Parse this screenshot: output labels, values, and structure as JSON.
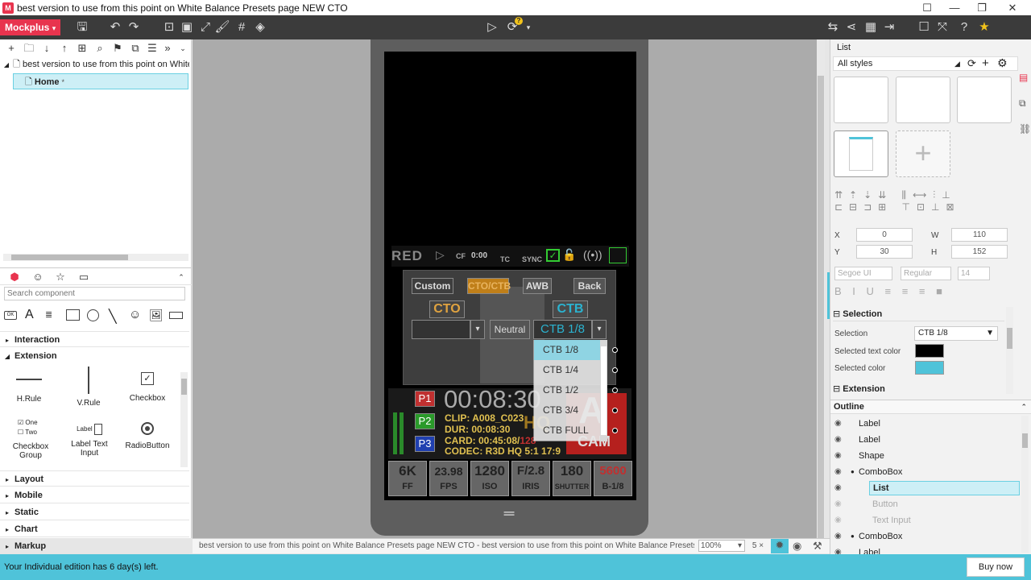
{
  "window": {
    "title": "best version to use from this point on White Balance Presets page NEW CTO",
    "app_badge": "M"
  },
  "toolbar": {
    "brand": "Mockplus",
    "brand_arrow": "▾",
    "update_badge": "?"
  },
  "pages": {
    "project_name": "best version to use from this point on White B",
    "home": "Home",
    "home_marker": "*"
  },
  "components": {
    "search_placeholder": "Search component",
    "sections": {
      "interaction": "Interaction",
      "extension": "Extension",
      "layout": "Layout",
      "mobile": "Mobile",
      "static": "Static",
      "chart": "Chart",
      "markup": "Markup"
    },
    "items": {
      "hrule": "H.Rule",
      "vrule": "V.Rule",
      "checkbox": "Checkbox",
      "checkbox_group": "Checkbox Group",
      "cbg_one": "One",
      "cbg_two": "Two",
      "label_text_input": "Label Text Input",
      "ltl": "Label",
      "radio_button": "RadioButton"
    },
    "icons": {
      "button": "OK",
      "text": "A"
    }
  },
  "camera": {
    "logo": "RED",
    "logo_arrow": "▷",
    "cf": "CF",
    "cf_time": "0:00",
    "tc": "TC",
    "sync": "SYNC",
    "buttons": {
      "custom": "Custom",
      "cto_ctb": "CTO/CTB",
      "awb": "AWB",
      "back": "Back",
      "cto": "CTO",
      "ctb": "CTB",
      "neutral": "Neutral"
    },
    "combo_value": "CTB 1/8",
    "combo_arrow": "▾",
    "list_items": [
      "CTB 1/8",
      "CTB 1/4",
      "CTB 1/2",
      "CTB 3/4",
      "CTB FULL"
    ],
    "presets": [
      "P1",
      "P2",
      "P3"
    ],
    "timecode": "00:08:30",
    "clip": "CLIP: A008_C023",
    "dur": "DUR: 00:08:30",
    "card": "CARD: 00:45:08/",
    "card_total": "128",
    "codec": "CODEC: R3D HQ 5:1 17:9",
    "hq": "HQ",
    "cam_letter": "A",
    "cam_label": "CAM",
    "stats": [
      {
        "v": "6K",
        "l": "FF"
      },
      {
        "v": "23.98",
        "l": "FPS"
      },
      {
        "v": "1280",
        "l": "ISO"
      },
      {
        "v": "F/2.8",
        "l": "IRIS"
      },
      {
        "v": "180",
        "l": "SHUTTER"
      },
      {
        "v": "5600",
        "l": "B-1/8"
      }
    ],
    "home_bar": "═"
  },
  "right": {
    "panel_title": "List",
    "styles": "All styles",
    "x_label": "X",
    "x": "0",
    "y_label": "Y",
    "y": "30",
    "w_label": "W",
    "w": "110",
    "h_label": "H",
    "h": "152",
    "font": "Segoe UI",
    "weight": "Regular",
    "size": "14",
    "selection_section": "Selection",
    "selection_label": "Selection",
    "selection_value": "CTB 1/8",
    "selected_text_color_label": "Selected text color",
    "selected_text_color": "#000000",
    "selected_color_label": "Selected color",
    "selected_color": "#4fc3d9",
    "extension_section": "Extension",
    "outline_title": "Outline",
    "outline": [
      "Label",
      "Label",
      "Shape",
      "ComboBox",
      "List",
      "Button",
      "Text Input",
      "ComboBox",
      "Label"
    ]
  },
  "status": {
    "path": "best version to use from this point on White Balance Presets page NEW CTO - best version to use from this point on White Balance Presets page NEW CTO",
    "zoom": "100%",
    "zoom_arrow": "▾",
    "close_label": "5 ×"
  },
  "notice": {
    "text": "Your Individual edition has 6 day(s) left.",
    "buy": "Buy now"
  }
}
